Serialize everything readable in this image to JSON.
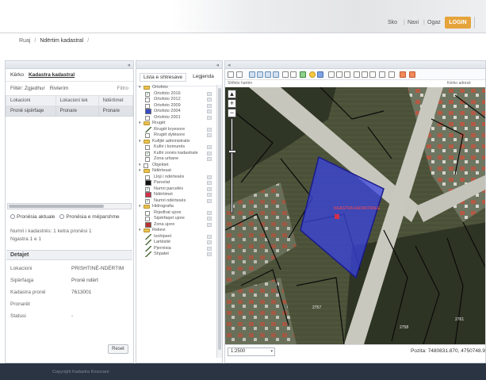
{
  "header": {
    "links": [
      "Sko",
      "Naxi",
      "Ogaz"
    ],
    "login_label": "LOGIN"
  },
  "breadcrumb": {
    "items": [
      "Ruaj",
      "Ndërtim kadastral"
    ]
  },
  "left_panel": {
    "tabs": [
      "Kërko",
      "Kadastra kadastral"
    ],
    "filter": {
      "left": "Filtër: Zgjedhur",
      "middle": "Rivlerim",
      "right": "Filtro"
    },
    "table": {
      "headers": [
        "Lokacioni",
        "Lokacioni tek",
        "Ndërtimet"
      ],
      "rows": [
        [
          "Pronë sipërfaqe",
          "Pronare",
          "Pronare"
        ]
      ]
    },
    "radio": {
      "option_a": "Pronësia aktuale",
      "option_b": "Pronësia e mëparshme"
    },
    "info_lines": [
      "Numri i kadastrës: 1 ketra pronësi 1",
      "Ngastra 1 e 1"
    ],
    "detail_title": "Detajet",
    "details": [
      {
        "label": "Lokacioni",
        "value": "PRISHTINË-NDËRTIM"
      },
      {
        "label": "Sipërfaqja",
        "value": "Pronë ndërt"
      },
      {
        "label": "Kadastra pronë",
        "value": "7613001"
      },
      {
        "label": "Pronarët",
        "value": ""
      },
      {
        "label": "Statusi",
        "value": "-"
      }
    ],
    "reset_label": "Reset"
  },
  "layers_panel": {
    "tabs": [
      "Lista e shtresave",
      "Legjenda"
    ],
    "layers": [
      {
        "label": "Ortofoto",
        "indent": 0,
        "type": "folder"
      },
      {
        "label": "Ortofoto 2016",
        "indent": 1,
        "type": "check",
        "checked": true
      },
      {
        "label": "Ortofoto 2012",
        "indent": 1,
        "type": "check",
        "checked": false
      },
      {
        "label": "Ortofoto 2009",
        "indent": 1,
        "type": "check",
        "checked": false
      },
      {
        "label": "Ortofoto 2004",
        "indent": 1,
        "type": "swatch",
        "color": "#3a4bc4"
      },
      {
        "label": "Ortofoto 2001",
        "indent": 1,
        "type": "check",
        "checked": false
      },
      {
        "label": "Rrugët",
        "indent": 0,
        "type": "folder"
      },
      {
        "label": "Rrugët kryesore",
        "indent": 1,
        "type": "line"
      },
      {
        "label": "Rrugët dytësore",
        "indent": 1,
        "type": "check",
        "checked": false
      },
      {
        "label": "Kufijtë administrativ",
        "indent": 0,
        "type": "folder"
      },
      {
        "label": "Kufiri i komunës",
        "indent": 1,
        "type": "check",
        "checked": false
      },
      {
        "label": "Kufiri zonës kadastrale",
        "indent": 1,
        "type": "check",
        "checked": true
      },
      {
        "label": "Zona urbane",
        "indent": 1,
        "type": "check",
        "checked": false
      },
      {
        "label": "Objektet",
        "indent": 0,
        "type": "check",
        "checked": false
      },
      {
        "label": "Ndërtesat",
        "indent": 0,
        "type": "folder"
      },
      {
        "label": "Lloji i ndërtesës",
        "indent": 1,
        "type": "check",
        "checked": false
      },
      {
        "label": "Parcelat",
        "indent": 1,
        "type": "swatch",
        "color": "#111111"
      },
      {
        "label": "Numri parcelës",
        "indent": 1,
        "type": "check",
        "checked": true
      },
      {
        "label": "Ndërtimet",
        "indent": 1,
        "type": "swatch",
        "color": "#d0304a"
      },
      {
        "label": "Numri ndërtesës",
        "indent": 1,
        "type": "check",
        "checked": true
      },
      {
        "label": "Hidrografia",
        "indent": 0,
        "type": "folder"
      },
      {
        "label": "Rrjedhat ujore",
        "indent": 1,
        "type": "check",
        "checked": false
      },
      {
        "label": "Sipërfaqet ujore",
        "indent": 1,
        "type": "check",
        "checked": false
      },
      {
        "label": "Zona ujore",
        "indent": 1,
        "type": "swatch",
        "color": "#b5332e"
      },
      {
        "label": "Relievi",
        "indent": 0,
        "type": "folder"
      },
      {
        "label": "Izohipset",
        "indent": 1,
        "type": "line"
      },
      {
        "label": "Lartësitë",
        "indent": 1,
        "type": "line"
      },
      {
        "label": "Pjerrësia",
        "indent": 1,
        "type": "line"
      },
      {
        "label": "Shpatet",
        "indent": 1,
        "type": "line"
      }
    ]
  },
  "map": {
    "subbar_left": "Shfleto hartën",
    "subbar_right": "Kërko adresë",
    "parcel_label": "NGASTRA KADASTRALE",
    "texts": [
      "2757",
      "2758",
      "2761"
    ],
    "scale_value": "1:2500",
    "coord_readout": "Pozita: 7480831.870,  4750748.9"
  },
  "footer": {
    "text": "Copyright Kadastra Kosovare"
  },
  "colors": {
    "accent": "#e5a43b",
    "footer_bg": "#2b3443",
    "parcel_fill": "#3b44e0"
  }
}
